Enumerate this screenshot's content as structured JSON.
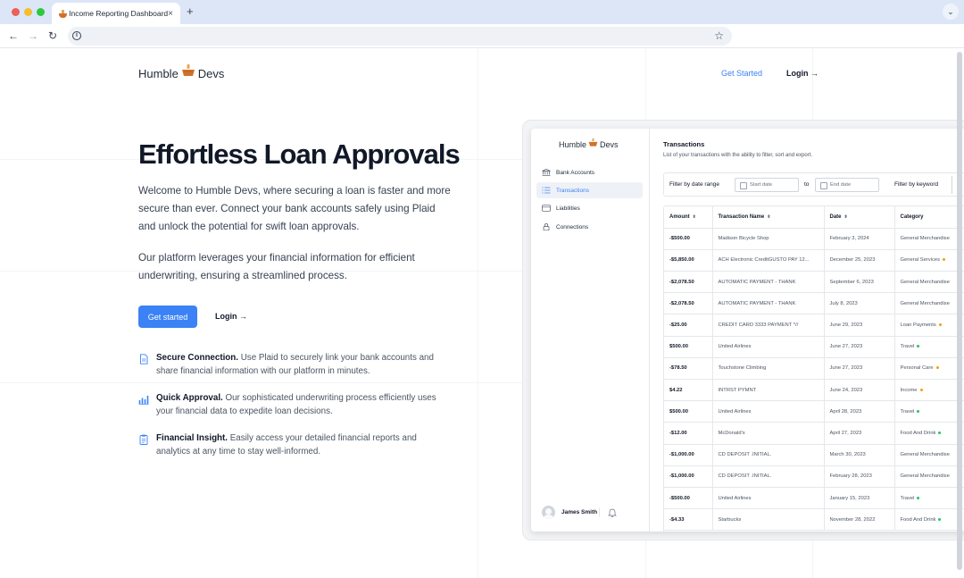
{
  "browser": {
    "tab_title": "Income Reporting Dashboard",
    "tab_close": "×",
    "new_tab": "+",
    "menu_chevron": "⌄",
    "back": "←",
    "forward": "→",
    "reload": "↻",
    "info": "i",
    "star": "☆"
  },
  "header": {
    "logo_left": "Humble",
    "logo_right": "Devs",
    "get_started": "Get Started",
    "login": "Login →"
  },
  "hero": {
    "title": "Effortless Loan Approvals",
    "paragraph1": "Welcome to Humble Devs, where securing a loan is faster and more secure than ever. Connect your bank accounts safely using Plaid and unlock the potential for swift loan approvals.",
    "paragraph2": "Our platform leverages your financial information for efficient underwriting, ensuring a streamlined process.",
    "cta_primary": "Get started",
    "cta_login": "Login →"
  },
  "features": [
    {
      "title": "Secure Connection.",
      "text": " Use Plaid to securely link your bank accounts and share financial information with our platform in minutes.",
      "icon": "document-icon"
    },
    {
      "title": "Quick Approval.",
      "text": " Our sophisticated underwriting process efficiently uses your financial data to expedite loan decisions.",
      "icon": "bar-chart-icon"
    },
    {
      "title": "Financial Insight.",
      "text": " Easily access your detailed financial reports and analytics at any time to stay well-informed.",
      "icon": "report-icon"
    }
  ],
  "dashboard": {
    "logo_left": "Humble",
    "logo_right": "Devs",
    "sidebar": [
      {
        "label": "Bank Accounts",
        "icon": "bank-icon",
        "active": false
      },
      {
        "label": "Transactions",
        "icon": "list-icon",
        "active": true
      },
      {
        "label": "Liabilities",
        "icon": "card-icon",
        "active": false
      },
      {
        "label": "Connections",
        "icon": "lock-icon",
        "active": false
      }
    ],
    "user_name": "James Smith",
    "title": "Transactions",
    "subtitle": "List of your transactions with the ability to filter, sort and export.",
    "filter": {
      "date_label": "Filter by date range",
      "start_placeholder": "Start date",
      "to": "to",
      "end_placeholder": "End date",
      "keyword_label": "Filter by keyword"
    },
    "columns": [
      "Amount",
      "Transaction Name",
      "Date",
      "Category"
    ],
    "sort_glyph": "⬍",
    "rows": [
      {
        "amount": "-$500.00",
        "name": "Madison Bicycle Shop",
        "date": "February 3, 2024",
        "category": "General Merchandise",
        "dot": ""
      },
      {
        "amount": "-$5,850.00",
        "name": "ACH Electronic CreditGUSTO PAY 12...",
        "date": "December 25, 2023",
        "category": "General Services",
        "dot": "#f59e0b"
      },
      {
        "amount": "-$2,078.50",
        "name": "AUTOMATIC PAYMENT - THANK",
        "date": "September 6, 2023",
        "category": "General Merchandise",
        "dot": ""
      },
      {
        "amount": "-$2,078.50",
        "name": "AUTOMATIC PAYMENT - THANK",
        "date": "July 8, 2023",
        "category": "General Merchandise",
        "dot": ""
      },
      {
        "amount": "-$25.00",
        "name": "CREDIT CARD 3333 PAYMENT *//",
        "date": "June 29, 2023",
        "category": "Loan Payments",
        "dot": "#f59e0b"
      },
      {
        "amount": "$500.00",
        "name": "United Airlines",
        "date": "June 27, 2023",
        "category": "Travel",
        "dot": "#22c55e"
      },
      {
        "amount": "-$78.50",
        "name": "Touchstone Climbing",
        "date": "June 27, 2023",
        "category": "Personal Care",
        "dot": "#f59e0b"
      },
      {
        "amount": "$4.22",
        "name": "INTRST PYMNT",
        "date": "June 24, 2023",
        "category": "Income",
        "dot": "#f59e0b"
      },
      {
        "amount": "$500.00",
        "name": "United Airlines",
        "date": "April 28, 2023",
        "category": "Travel",
        "dot": "#22c55e"
      },
      {
        "amount": "-$12.00",
        "name": "McDonald's",
        "date": "April 27, 2023",
        "category": "Food And Drink",
        "dot": "#22c55e"
      },
      {
        "amount": "-$1,000.00",
        "name": "CD DEPOSIT .INITIAL.",
        "date": "March 30, 2023",
        "category": "General Merchandise",
        "dot": ""
      },
      {
        "amount": "-$1,000.00",
        "name": "CD DEPOSIT .INITIAL.",
        "date": "February 28, 2023",
        "category": "General Merchandise",
        "dot": ""
      },
      {
        "amount": "-$500.00",
        "name": "United Airlines",
        "date": "January 15, 2023",
        "category": "Travel",
        "dot": "#22c55e"
      },
      {
        "amount": "-$4.33",
        "name": "Starbucks",
        "date": "November 28, 2022",
        "category": "Food And Drink",
        "dot": "#22c55e"
      }
    ]
  },
  "colors": {
    "accent": "#3b82f6",
    "brand_orange": "#d2712c"
  }
}
